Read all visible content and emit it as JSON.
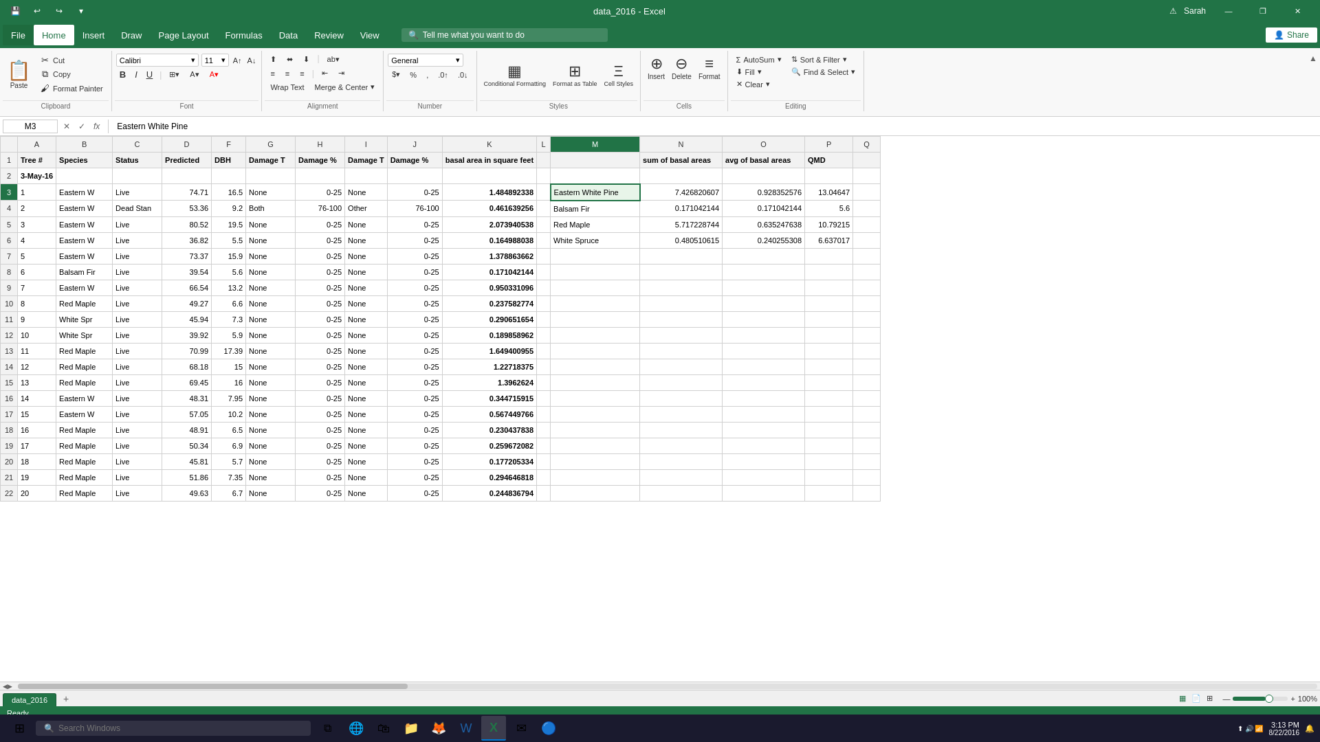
{
  "app": {
    "title": "data_2016 - Excel",
    "version": "Excel"
  },
  "titlebar": {
    "save_icon": "💾",
    "undo_icon": "↩",
    "redo_icon": "↪",
    "customize_icon": "▾",
    "user": "Sarah",
    "warning_icon": "⚠",
    "minimize_label": "—",
    "restore_label": "❐",
    "close_label": "✕"
  },
  "menubar": {
    "items": [
      "File",
      "Home",
      "Insert",
      "Draw",
      "Page Layout",
      "Formulas",
      "Data",
      "Review",
      "View"
    ],
    "active": "Home",
    "tellme_placeholder": "Tell me what you want to do",
    "share_label": "Share"
  },
  "ribbon": {
    "clipboard_label": "Clipboard",
    "font_label": "Font",
    "alignment_label": "Alignment",
    "number_label": "Number",
    "styles_label": "Styles",
    "cells_label": "Cells",
    "editing_label": "Editing",
    "paste_label": "Paste",
    "cut_label": "Cut",
    "copy_label": "Copy",
    "format_painter_label": "Format Painter",
    "font_name": "Calibri",
    "font_size": "11",
    "bold_label": "B",
    "italic_label": "I",
    "underline_label": "U",
    "wrap_text_label": "Wrap Text",
    "merge_center_label": "Merge & Center",
    "number_format": "General",
    "conditional_formatting_label": "Conditional Formatting",
    "format_as_table_label": "Format as Table",
    "cell_styles_label": "Cell Styles",
    "insert_label": "Insert",
    "delete_label": "Delete",
    "format_label": "Format",
    "autosum_label": "AutoSum",
    "fill_label": "Fill",
    "clear_label": "Clear",
    "sort_filter_label": "Sort & Filter",
    "find_select_label": "Find & Select"
  },
  "formulabar": {
    "cell_reference": "M3",
    "formula_content": "Eastern White Pine",
    "cancel_label": "✕",
    "confirm_label": "✓",
    "function_label": "fx"
  },
  "columns": {
    "headers": [
      "",
      "A",
      "B",
      "C",
      "D",
      "F",
      "G",
      "H",
      "I",
      "J",
      "K",
      "L",
      "M",
      "N",
      "O",
      "P",
      "Q"
    ],
    "widths": [
      25,
      55,
      80,
      70,
      70,
      50,
      70,
      70,
      60,
      80,
      120,
      20,
      130,
      120,
      120,
      70,
      40
    ]
  },
  "rows": [
    {
      "row": 1,
      "cells": [
        "Tree #",
        "Species",
        "Status",
        "Predicted",
        "DBH",
        "Damage T",
        "Damage %",
        "Damage T",
        "Damage %",
        "basal area in square feet",
        "",
        "",
        "sum of basal areas",
        "avg of basal areas",
        "QMD",
        ""
      ]
    },
    {
      "row": 2,
      "cells": [
        "3-May-16",
        "",
        "",
        "",
        "",
        "",
        "",
        "",
        "",
        "",
        "",
        "",
        "",
        "",
        "",
        ""
      ]
    },
    {
      "row": 3,
      "cells": [
        "1",
        "Eastern W",
        "Live",
        "74.71",
        "16.5",
        "None",
        "0-25",
        "None",
        "0-25",
        "1.484892338",
        "",
        "Eastern White Pine",
        "7.426820607",
        "0.928352576",
        "13.04647",
        ""
      ]
    },
    {
      "row": 4,
      "cells": [
        "2",
        "Eastern W",
        "Dead Stan",
        "53.36",
        "9.2",
        "Both",
        "76-100",
        "Other",
        "76-100",
        "0.461639256",
        "",
        "Balsam Fir",
        "0.171042144",
        "0.171042144",
        "5.6",
        ""
      ]
    },
    {
      "row": 5,
      "cells": [
        "3",
        "Eastern W",
        "Live",
        "80.52",
        "19.5",
        "None",
        "0-25",
        "None",
        "0-25",
        "2.073940538",
        "",
        "Red Maple",
        "5.717228744",
        "0.635247638",
        "10.79215",
        ""
      ]
    },
    {
      "row": 6,
      "cells": [
        "4",
        "Eastern W",
        "Live",
        "36.82",
        "5.5",
        "None",
        "0-25",
        "None",
        "0-25",
        "0.164988038",
        "",
        "White Spruce",
        "0.480510615",
        "0.240255308",
        "6.637017",
        ""
      ]
    },
    {
      "row": 7,
      "cells": [
        "5",
        "Eastern W",
        "Live",
        "73.37",
        "15.9",
        "None",
        "0-25",
        "None",
        "0-25",
        "1.378863662",
        "",
        "",
        "",
        "",
        "",
        ""
      ]
    },
    {
      "row": 8,
      "cells": [
        "6",
        "Balsam Fir",
        "Live",
        "39.54",
        "5.6",
        "None",
        "0-25",
        "None",
        "0-25",
        "0.171042144",
        "",
        "",
        "",
        "",
        "",
        ""
      ]
    },
    {
      "row": 9,
      "cells": [
        "7",
        "Eastern W",
        "Live",
        "66.54",
        "13.2",
        "None",
        "0-25",
        "None",
        "0-25",
        "0.950331096",
        "",
        "",
        "",
        "",
        "",
        ""
      ]
    },
    {
      "row": 10,
      "cells": [
        "8",
        "Red Maple",
        "Live",
        "49.27",
        "6.6",
        "None",
        "0-25",
        "None",
        "0-25",
        "0.237582774",
        "",
        "",
        "",
        "",
        "",
        ""
      ]
    },
    {
      "row": 11,
      "cells": [
        "9",
        "White Spr",
        "Live",
        "45.94",
        "7.3",
        "None",
        "0-25",
        "None",
        "0-25",
        "0.290651654",
        "",
        "",
        "",
        "",
        "",
        ""
      ]
    },
    {
      "row": 12,
      "cells": [
        "10",
        "White Spr",
        "Live",
        "39.92",
        "5.9",
        "None",
        "0-25",
        "None",
        "0-25",
        "0.189858962",
        "",
        "",
        "",
        "",
        "",
        ""
      ]
    },
    {
      "row": 13,
      "cells": [
        "11",
        "Red Maple",
        "Live",
        "70.99",
        "17.39",
        "None",
        "0-25",
        "None",
        "0-25",
        "1.649400955",
        "",
        "",
        "",
        "",
        "",
        ""
      ]
    },
    {
      "row": 14,
      "cells": [
        "12",
        "Red Maple",
        "Live",
        "68.18",
        "15",
        "None",
        "0-25",
        "None",
        "0-25",
        "1.22718375",
        "",
        "",
        "",
        "",
        "",
        ""
      ]
    },
    {
      "row": 15,
      "cells": [
        "13",
        "Red Maple",
        "Live",
        "69.45",
        "16",
        "None",
        "0-25",
        "None",
        "0-25",
        "1.3962624",
        "",
        "",
        "",
        "",
        "",
        ""
      ]
    },
    {
      "row": 16,
      "cells": [
        "14",
        "Eastern W",
        "Live",
        "48.31",
        "7.95",
        "None",
        "0-25",
        "None",
        "0-25",
        "0.344715915",
        "",
        "",
        "",
        "",
        "",
        ""
      ]
    },
    {
      "row": 17,
      "cells": [
        "15",
        "Eastern W",
        "Live",
        "57.05",
        "10.2",
        "None",
        "0-25",
        "None",
        "0-25",
        "0.567449766",
        "",
        "",
        "",
        "",
        "",
        ""
      ]
    },
    {
      "row": 18,
      "cells": [
        "16",
        "Red Maple",
        "Live",
        "48.91",
        "6.5",
        "None",
        "0-25",
        "None",
        "0-25",
        "0.230437838",
        "",
        "",
        "",
        "",
        "",
        ""
      ]
    },
    {
      "row": 19,
      "cells": [
        "17",
        "Red Maple",
        "Live",
        "50.34",
        "6.9",
        "None",
        "0-25",
        "None",
        "0-25",
        "0.259672082",
        "",
        "",
        "",
        "",
        "",
        ""
      ]
    },
    {
      "row": 20,
      "cells": [
        "18",
        "Red Maple",
        "Live",
        "45.81",
        "5.7",
        "None",
        "0-25",
        "None",
        "0-25",
        "0.177205334",
        "",
        "",
        "",
        "",
        "",
        ""
      ]
    },
    {
      "row": 21,
      "cells": [
        "19",
        "Red Maple",
        "Live",
        "51.86",
        "7.35",
        "None",
        "0-25",
        "None",
        "0-25",
        "0.294646818",
        "",
        "",
        "",
        "",
        "",
        ""
      ]
    },
    {
      "row": 22,
      "cells": [
        "20",
        "Red Maple",
        "Live",
        "49.63",
        "6.7",
        "None",
        "0-25",
        "None",
        "0-25",
        "0.244836794",
        "",
        "",
        "",
        "",
        "",
        ""
      ]
    }
  ],
  "sheet": {
    "tab_name": "data_2016",
    "add_label": "+",
    "status": "Ready"
  },
  "statusbar": {
    "status": "Ready",
    "view_normal": "▦",
    "view_page": "📄",
    "view_page_break": "⊞",
    "zoom_level": "100%",
    "plus_label": "+",
    "minus_label": "−"
  },
  "taskbar": {
    "search_placeholder": "Search Windows",
    "time": "3:13 PM",
    "date": "8/22/2016"
  }
}
